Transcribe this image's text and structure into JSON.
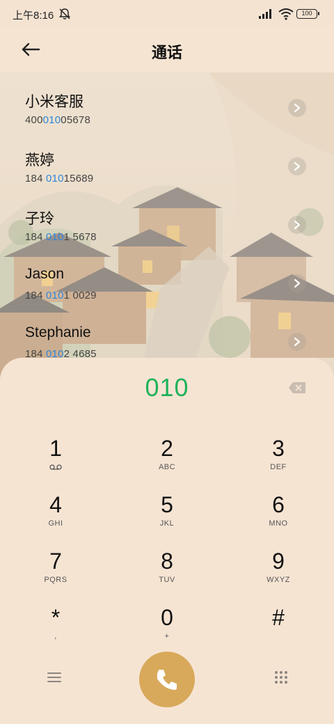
{
  "status": {
    "time": "上午8:16",
    "battery": "100"
  },
  "header": {
    "title": "通话"
  },
  "contacts": [
    {
      "name": "小米客服",
      "num_pre": "400",
      "num_hl": "010",
      "num_post": "05678"
    },
    {
      "name": "燕婷",
      "num_pre": "184 ",
      "num_hl": "010",
      "num_post": "15689"
    },
    {
      "name": "子玲",
      "num_pre": "184 ",
      "num_hl": "010",
      "num_post": "1 5678"
    },
    {
      "name": "Jason",
      "num_pre": "184 ",
      "num_hl": "010",
      "num_post": "1 0029"
    },
    {
      "name": "Stephanie",
      "num_pre": "184 ",
      "num_hl": "010",
      "num_post": "2 4685"
    }
  ],
  "dialer": {
    "input": "010",
    "keys": [
      {
        "digit": "1",
        "letters": ""
      },
      {
        "digit": "2",
        "letters": "ABC"
      },
      {
        "digit": "3",
        "letters": "DEF"
      },
      {
        "digit": "4",
        "letters": "GHI"
      },
      {
        "digit": "5",
        "letters": "JKL"
      },
      {
        "digit": "6",
        "letters": "MNO"
      },
      {
        "digit": "7",
        "letters": "PQRS"
      },
      {
        "digit": "8",
        "letters": "TUV"
      },
      {
        "digit": "9",
        "letters": "WXYZ"
      },
      {
        "digit": "*",
        "letters": ","
      },
      {
        "digit": "0",
        "letters": "+"
      },
      {
        "digit": "#",
        "letters": ""
      }
    ]
  },
  "colors": {
    "highlight": "#2f86d8",
    "input": "#1fb25a",
    "call": "#d8a95a"
  }
}
